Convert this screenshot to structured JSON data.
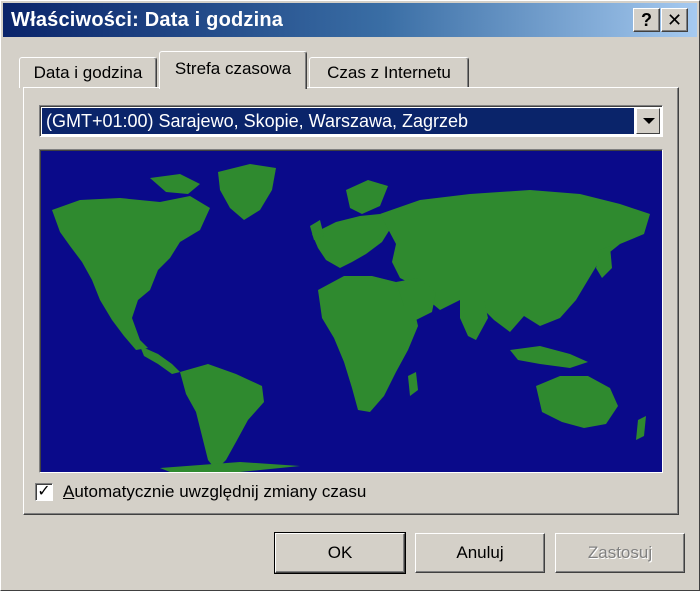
{
  "window": {
    "title": "Właściwości: Data i godzina",
    "help_glyph": "?",
    "close_glyph": "✕"
  },
  "tabs": [
    {
      "label": "Data i godzina",
      "active": false
    },
    {
      "label": "Strefa czasowa",
      "active": true
    },
    {
      "label": "Czas z Internetu",
      "active": false
    }
  ],
  "timezone": {
    "selected": "(GMT+01:00) Sarajewo, Skopie, Warszawa, Zagrzeb"
  },
  "map": {
    "ocean_color": "#0a0a8a",
    "land_color": "#2f8a2f"
  },
  "dst_checkbox": {
    "checked": true,
    "check_glyph": "✓",
    "label_accel": "A",
    "label_rest": "utomatycznie uwzględnij zmiany czasu"
  },
  "buttons": {
    "ok": "OK",
    "cancel": "Anuluj",
    "apply": "Zastosuj",
    "apply_enabled": false
  }
}
